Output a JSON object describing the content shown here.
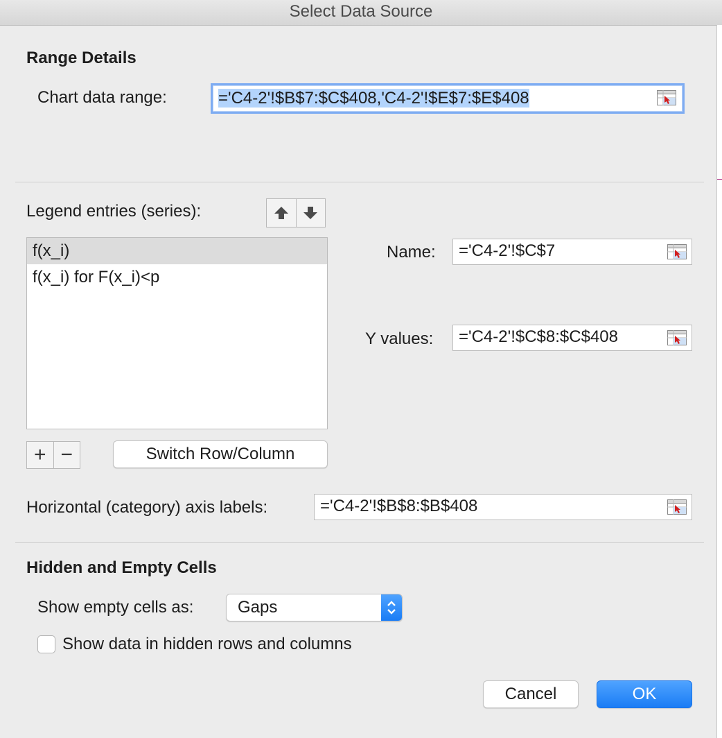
{
  "window": {
    "title": "Select Data Source"
  },
  "range_details": {
    "heading": "Range Details",
    "chart_range_label": "Chart data range:",
    "chart_range_value": "='C4-2'!$B$7:$C$408,'C4-2'!$E$7:$E$408"
  },
  "legend": {
    "label": "Legend entries (series):",
    "items": [
      "f(x_i)",
      "f(x_i) for F(x_i)<p"
    ],
    "name_label": "Name:",
    "name_value": "='C4-2'!$C$7",
    "y_label": "Y values:",
    "y_value": "='C4-2'!$C$8:$C$408",
    "add_symbol": "+",
    "remove_symbol": "−",
    "switch_label": "Switch Row/Column"
  },
  "axis": {
    "label": "Horizontal (category) axis labels:",
    "value": "='C4-2'!$B$8:$B$408"
  },
  "hidden_empty": {
    "heading": "Hidden and Empty Cells",
    "show_empty_label": "Show empty cells as:",
    "show_empty_value": "Gaps",
    "hidden_rows_label": "Show data in hidden rows and columns"
  },
  "buttons": {
    "cancel": "Cancel",
    "ok": "OK"
  },
  "colors": {
    "accent": "#1a7cf5",
    "focus_ring": "#7eacf2",
    "selection": "#b3d4fc"
  }
}
